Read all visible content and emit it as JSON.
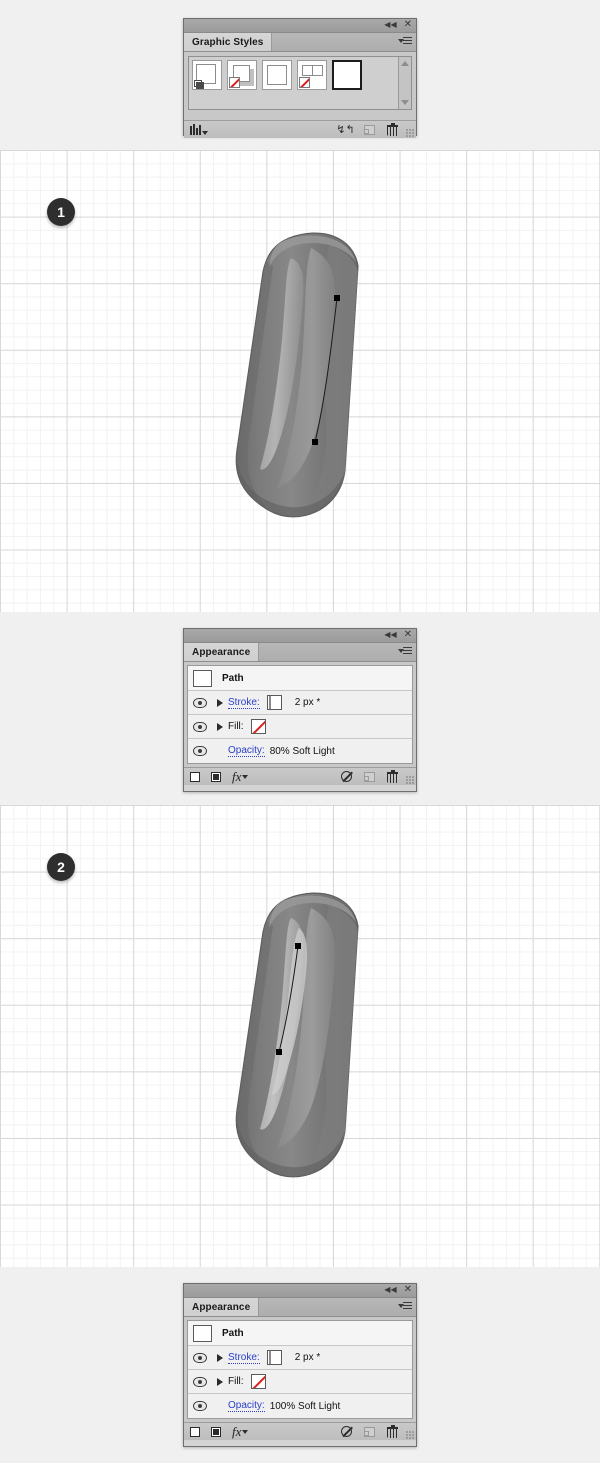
{
  "background_color": "#f0f0f0",
  "panels": {
    "graphic_styles": {
      "title": "Graphic Styles",
      "topbar": {
        "collapse_icon": "double-left-chevron-icon",
        "close_icon": "close-icon"
      },
      "menu_icon": "panel-menu-icon",
      "swatches": [
        {
          "name": "drop-shadow-style",
          "selected": false
        },
        {
          "name": "no-fill-shadow-style",
          "selected": false
        },
        {
          "name": "blank-style",
          "selected": false
        },
        {
          "name": "no-fill-split-style",
          "selected": false
        },
        {
          "name": "white-style",
          "selected": true
        }
      ],
      "scrollbar": {
        "up_icon": "scroll-up-arrow-icon",
        "down_icon": "scroll-down-arrow-icon"
      },
      "footer_icons": [
        "graphic-styles-libraries-icon",
        "break-link-to-style-icon",
        "new-graphic-style-icon",
        "delete-graphic-style-icon"
      ]
    },
    "appearance_1": {
      "title": "Appearance",
      "target": "Path",
      "rows": [
        {
          "type": "stroke",
          "label": "Stroke:",
          "value": "2 px *",
          "swatch": "white",
          "visible": true,
          "expandable": true
        },
        {
          "type": "fill",
          "label": "Fill:",
          "value": "",
          "swatch": "none",
          "visible": true,
          "expandable": true
        },
        {
          "type": "opacity",
          "label": "Opacity:",
          "value": "80% Soft Light",
          "visible": true,
          "expandable": false
        }
      ],
      "footer_icons": [
        "add-new-stroke-icon",
        "add-new-fill-icon",
        "add-new-effect-icon",
        "clear-appearance-icon",
        "duplicate-selected-item-icon",
        "delete-selected-item-icon"
      ]
    },
    "appearance_2": {
      "title": "Appearance",
      "target": "Path",
      "rows": [
        {
          "type": "stroke",
          "label": "Stroke:",
          "value": "2 px *",
          "swatch": "white",
          "visible": true,
          "expandable": true
        },
        {
          "type": "fill",
          "label": "Fill:",
          "value": "",
          "swatch": "none",
          "visible": true,
          "expandable": true
        },
        {
          "type": "opacity",
          "label": "Opacity:",
          "value": "100% Soft Light",
          "visible": true,
          "expandable": false
        }
      ],
      "footer_icons": [
        "add-new-stroke-icon",
        "add-new-fill-icon",
        "add-new-effect-icon",
        "clear-appearance-icon",
        "duplicate-selected-item-icon",
        "delete-selected-item-icon"
      ]
    }
  },
  "steps": [
    {
      "number": "1",
      "artwork": "glossy-gray-pill-with-right-highlight-path"
    },
    {
      "number": "2",
      "artwork": "glossy-gray-pill-with-center-highlight-path"
    }
  ],
  "artwork_colors": {
    "pill_dark": "#6e6e6e",
    "pill_mid": "#808080",
    "pill_light": "#9c9c9c",
    "pill_highlight": "#b4b4b4",
    "pill_outline": "#5a5a5a",
    "path_stroke": "#1a1a1a",
    "anchor_point": "#000000"
  },
  "canvas": {
    "grid_minor_color": "#f2f2f2",
    "grid_major_color": "#d8d8d8",
    "paper_color": "#ffffff"
  }
}
